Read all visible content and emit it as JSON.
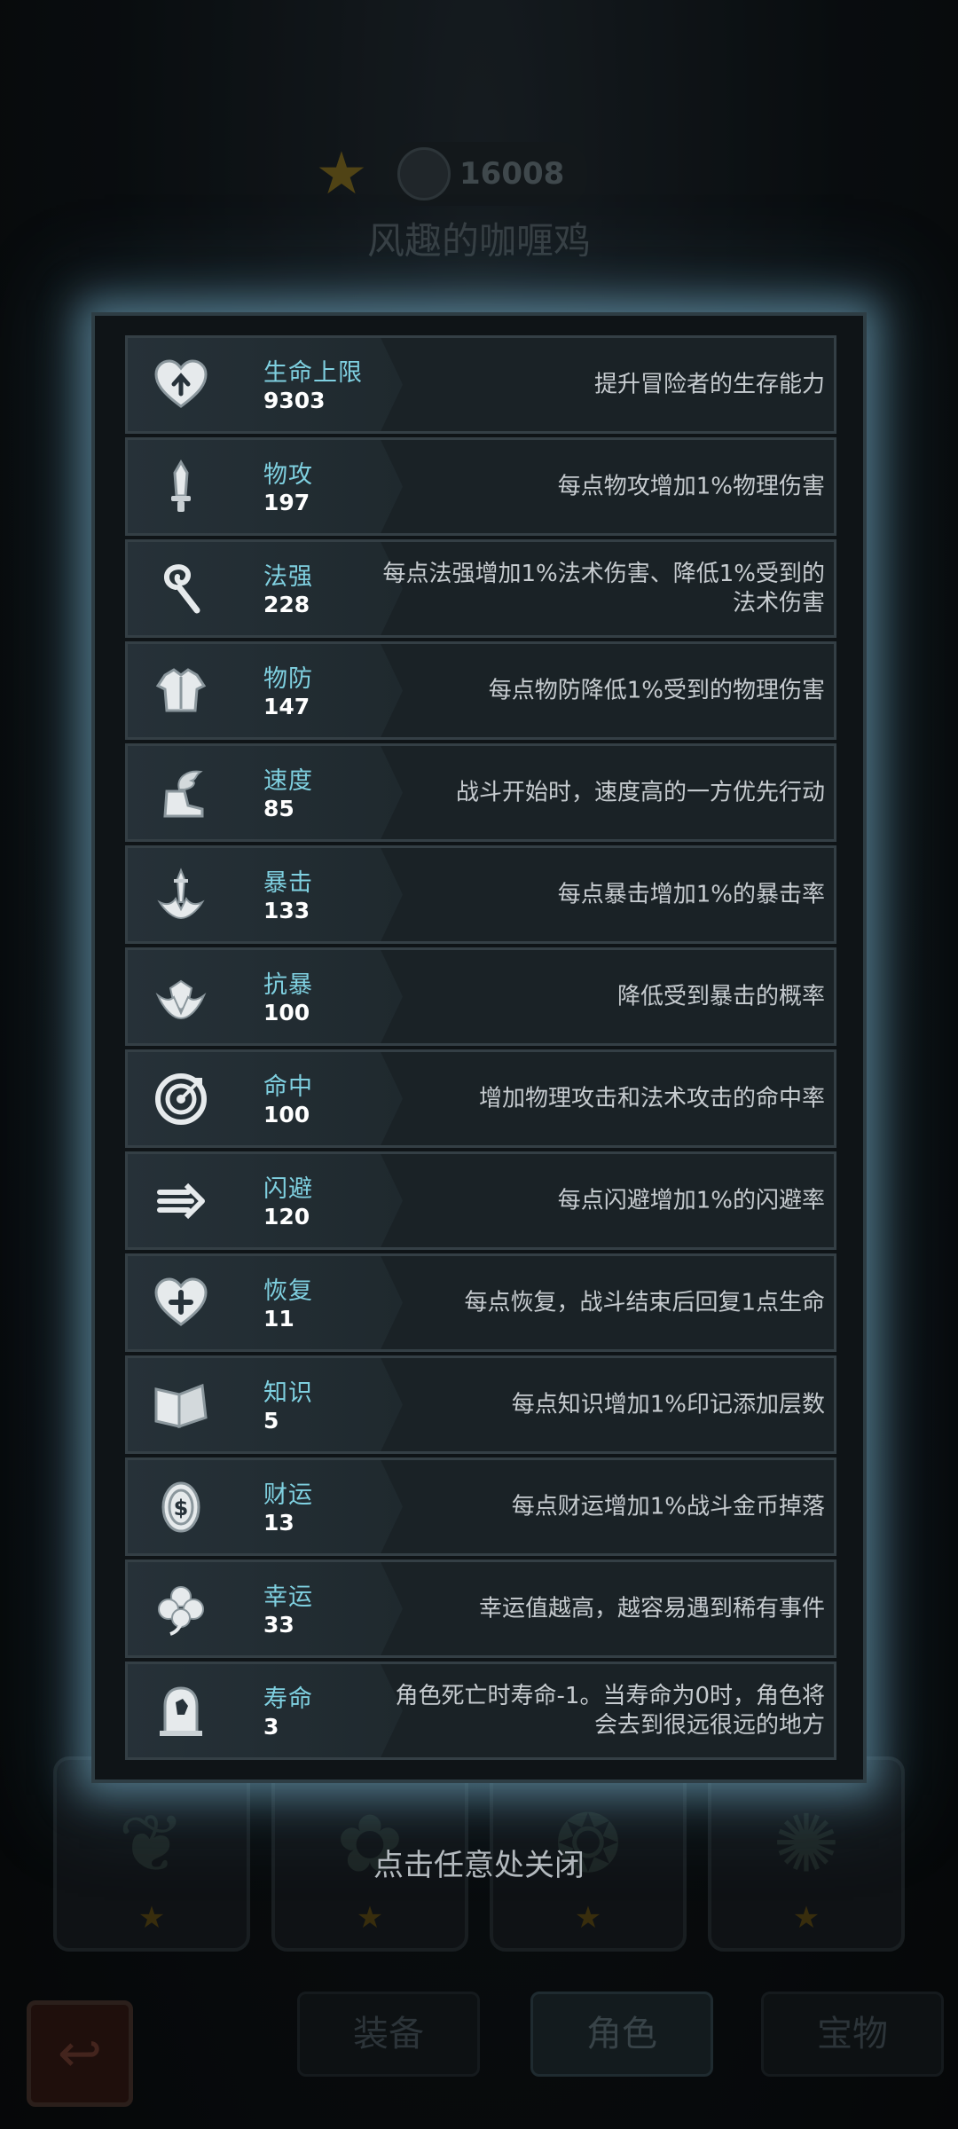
{
  "background": {
    "power": "16008",
    "character_name": "风趣的咖喱鸡",
    "tabs": [
      "装备",
      "角色",
      "宝物"
    ]
  },
  "stats": [
    {
      "name": "生命上限",
      "value": "9303",
      "desc": "提升冒险者的生存能力",
      "icon": "heart-up-icon"
    },
    {
      "name": "物攻",
      "value": "197",
      "desc": "每点物攻增加1%物理伤害",
      "icon": "sword-icon"
    },
    {
      "name": "法强",
      "value": "228",
      "desc": "每点法强增加1%法术伤害、降低1%受到的法术伤害",
      "icon": "staff-icon"
    },
    {
      "name": "物防",
      "value": "147",
      "desc": "每点物防降低1%受到的物理伤害",
      "icon": "armor-icon"
    },
    {
      "name": "速度",
      "value": "85",
      "desc": "战斗开始时，速度高的一方优先行动",
      "icon": "winged-boot-icon"
    },
    {
      "name": "暴击",
      "value": "133",
      "desc": "每点暴击增加1%的暴击率",
      "icon": "crit-dagger-icon"
    },
    {
      "name": "抗暴",
      "value": "100",
      "desc": "降低受到暴击的概率",
      "icon": "crit-shield-icon"
    },
    {
      "name": "命中",
      "value": "100",
      "desc": "增加物理攻击和法术攻击的命中率",
      "icon": "target-icon"
    },
    {
      "name": "闪避",
      "value": "120",
      "desc": "每点闪避增加1%的闪避率",
      "icon": "dodge-arrow-icon"
    },
    {
      "name": "恢复",
      "value": "11",
      "desc": "每点恢复，战斗结束后回复1点生命",
      "icon": "heart-plus-icon"
    },
    {
      "name": "知识",
      "value": "5",
      "desc": "每点知识增加1%印记添加层数",
      "icon": "book-icon"
    },
    {
      "name": "财运",
      "value": "13",
      "desc": "每点财运增加1%战斗金币掉落",
      "icon": "coin-icon"
    },
    {
      "name": "幸运",
      "value": "33",
      "desc": "幸运值越高，越容易遇到稀有事件",
      "icon": "clover-icon"
    },
    {
      "name": "寿命",
      "value": "3",
      "desc": "角色死亡时寿命-1。当寿命为0时，角色将会去到很远很远的地方",
      "icon": "tombstone-icon"
    }
  ],
  "close_hint": "点击任意处关闭"
}
